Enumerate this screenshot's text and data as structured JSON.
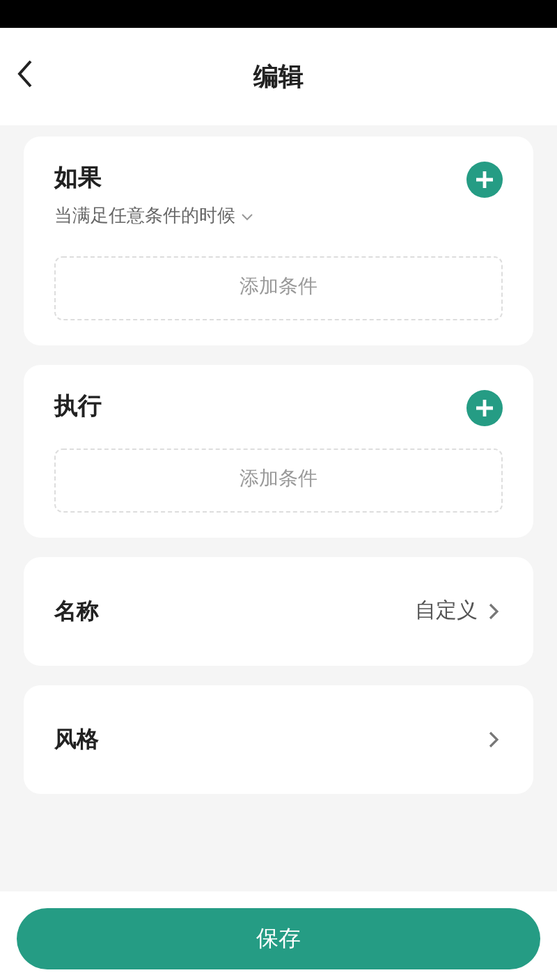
{
  "header": {
    "title": "编辑"
  },
  "sections": [
    {
      "title": "如果",
      "subtitle": "当满足任意条件的时候",
      "placeholder": "添加条件"
    },
    {
      "title": "执行",
      "placeholder": "添加条件"
    }
  ],
  "rows": [
    {
      "label": "名称",
      "value": "自定义"
    },
    {
      "label": "风格"
    }
  ],
  "save_button": "保存"
}
